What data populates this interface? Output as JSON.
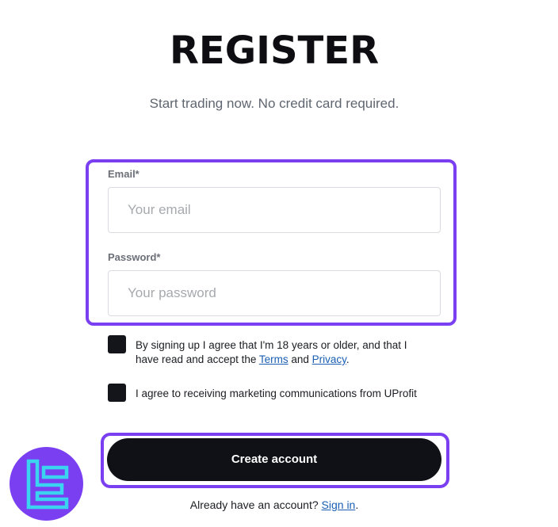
{
  "header": {
    "title": "REGISTER",
    "subtitle": "Start trading now. No credit card required."
  },
  "form": {
    "email": {
      "label": "Email*",
      "placeholder": "Your email",
      "value": ""
    },
    "password": {
      "label": "Password*",
      "placeholder": "Your password",
      "value": ""
    },
    "agreements": {
      "terms_prefix": "By signing up I agree that I'm 18 years or older, and that I have read and accept the ",
      "terms_link": "Terms",
      "and_text": " and ",
      "privacy_link": "Privacy",
      "period": ".",
      "marketing_text": "I agree to receiving marketing communications from UProfit"
    },
    "submit_label": "Create account",
    "signin_prompt": "Already have an account? ",
    "signin_link": "Sign in",
    "signin_period": "."
  },
  "logo": {
    "icon": "tc-logo-icon"
  },
  "colors": {
    "highlight": "#7b3ff2",
    "button": "#0f1116",
    "link": "#1a5fb4",
    "logo_bg": "#7b3ff2",
    "logo_glyph": "#3ad4f0"
  }
}
